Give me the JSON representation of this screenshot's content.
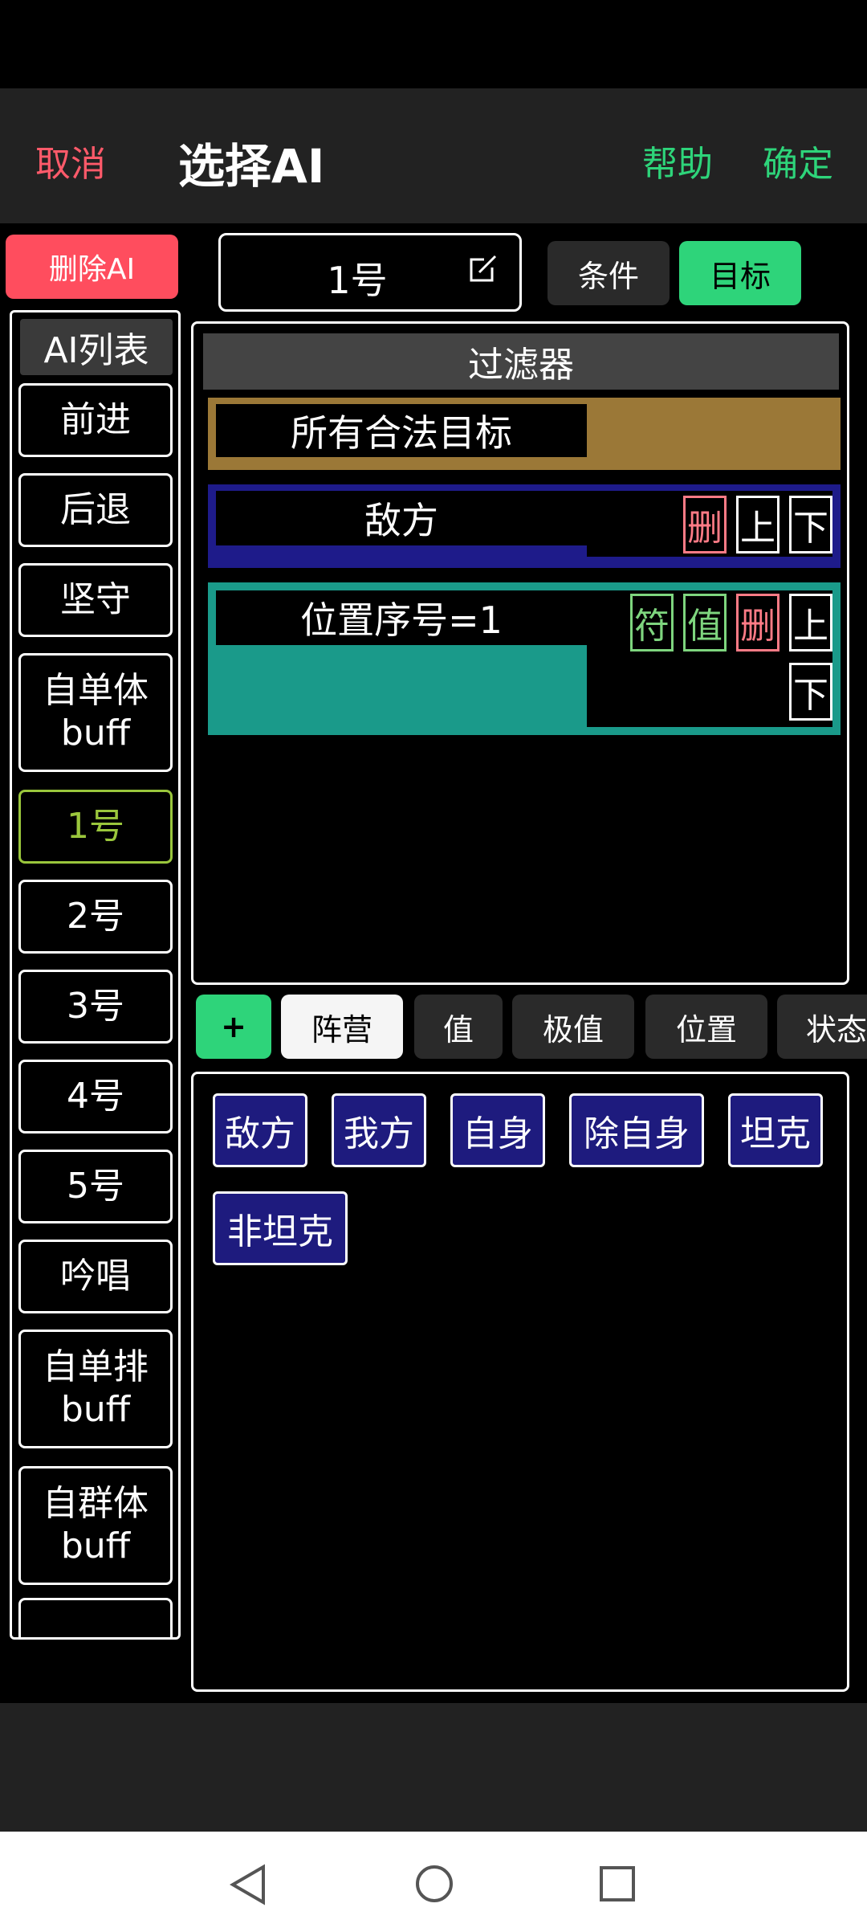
{
  "header": {
    "cancel": "取消",
    "title": "选择AI",
    "help": "帮助",
    "confirm": "确定"
  },
  "delete_ai": "删除AI",
  "ai_list": {
    "title": "AI列表",
    "items": [
      {
        "label": "前进"
      },
      {
        "label": "后退"
      },
      {
        "label": "坚守"
      },
      {
        "label": "自单体\nbuff"
      },
      {
        "label": "1号",
        "selected": true
      },
      {
        "label": "2号"
      },
      {
        "label": "3号"
      },
      {
        "label": "4号"
      },
      {
        "label": "5号"
      },
      {
        "label": "吟唱"
      },
      {
        "label": "自单排\nbuff"
      },
      {
        "label": "自群体\nbuff"
      }
    ]
  },
  "ai_name": "1号",
  "tabs": {
    "condition": "条件",
    "target": "目标"
  },
  "filter": {
    "title": "过滤器",
    "rules": [
      {
        "label": "所有合法目标",
        "color": "#9b7837"
      },
      {
        "label": "敌方",
        "color": "#1e1b8a",
        "buttons": [
          "删",
          "上",
          "下"
        ]
      },
      {
        "label": "位置序号=1",
        "color": "#1a9a8a",
        "buttons": [
          "符",
          "值",
          "删",
          "上",
          "下"
        ]
      }
    ]
  },
  "category_tabs": [
    "+",
    "阵营",
    "值",
    "极值",
    "位置",
    "状态"
  ],
  "options": [
    "敌方",
    "我方",
    "自身",
    "除自身",
    "坦克",
    "非坦克"
  ],
  "colors": {
    "accent_green": "#2ed47a",
    "cancel_red": "#ff5a6a",
    "selected": "#9ac63c"
  }
}
